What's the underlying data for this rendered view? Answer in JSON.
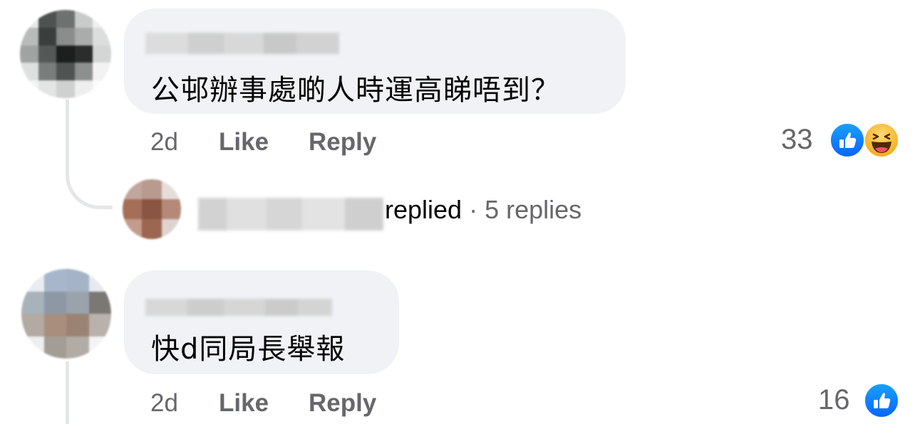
{
  "comments": [
    {
      "text": "公邨辦事處啲人時運高睇唔到？",
      "time": "2d",
      "like_label": "Like",
      "reply_label": "Reply",
      "reaction_count": "33",
      "reactions": [
        "like-icon",
        "haha-icon"
      ]
    },
    {
      "text": "快d同局長舉報",
      "time": "2d",
      "like_label": "Like",
      "reply_label": "Reply",
      "reaction_count": "16",
      "reactions": [
        "like-icon"
      ]
    }
  ],
  "reply_thread": {
    "replied_label": "replied",
    "separator": "·",
    "replies_count": "5 replies"
  },
  "colors": {
    "bubble": "#f0f2f5",
    "muted_text": "#65676b",
    "text": "#050505",
    "like_blue": "#0866ff",
    "haha_yellow": "#f7b125",
    "thread_line": "#e4e6eb"
  }
}
